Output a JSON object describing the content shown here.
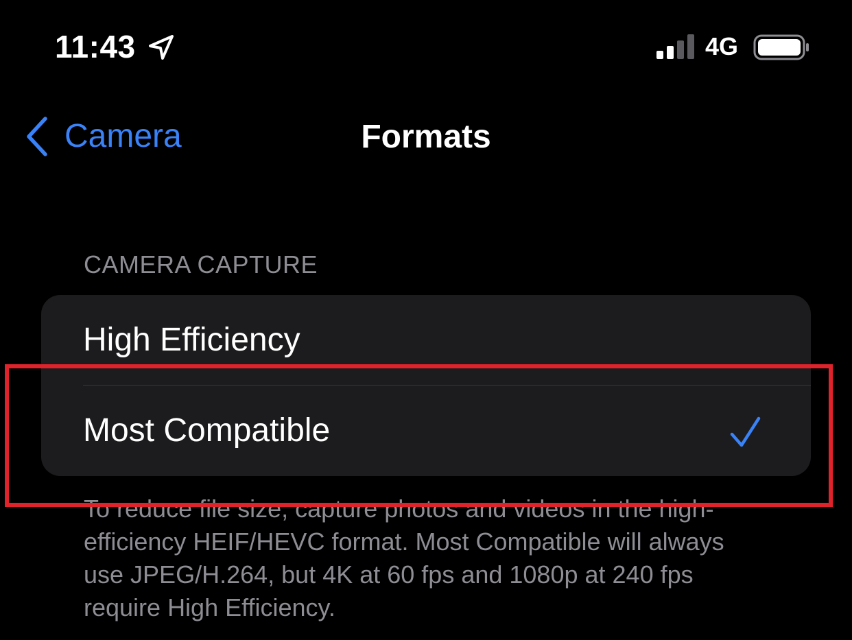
{
  "status_bar": {
    "time": "11:43",
    "network": "4G",
    "icons": [
      "location-arrow-icon",
      "signal-icon",
      "battery-icon"
    ]
  },
  "nav": {
    "back_label": "Camera",
    "title": "Formats"
  },
  "section": {
    "header": "CAMERA CAPTURE",
    "options": [
      {
        "label": "High Efficiency",
        "selected": false
      },
      {
        "label": "Most Compatible",
        "selected": true
      }
    ],
    "footer": "To reduce file size, capture photos and videos in the high-efficiency HEIF/HEVC format. Most Compatible will always use JPEG/H.264, but 4K at 60 fps and 1080p at 240 fps require High Efficiency."
  },
  "colors": {
    "background": "#000000",
    "group_background": "#1c1c1e",
    "accent": "#3a82f7",
    "secondary_text": "#8d8d93",
    "highlight": "#e0232b"
  }
}
